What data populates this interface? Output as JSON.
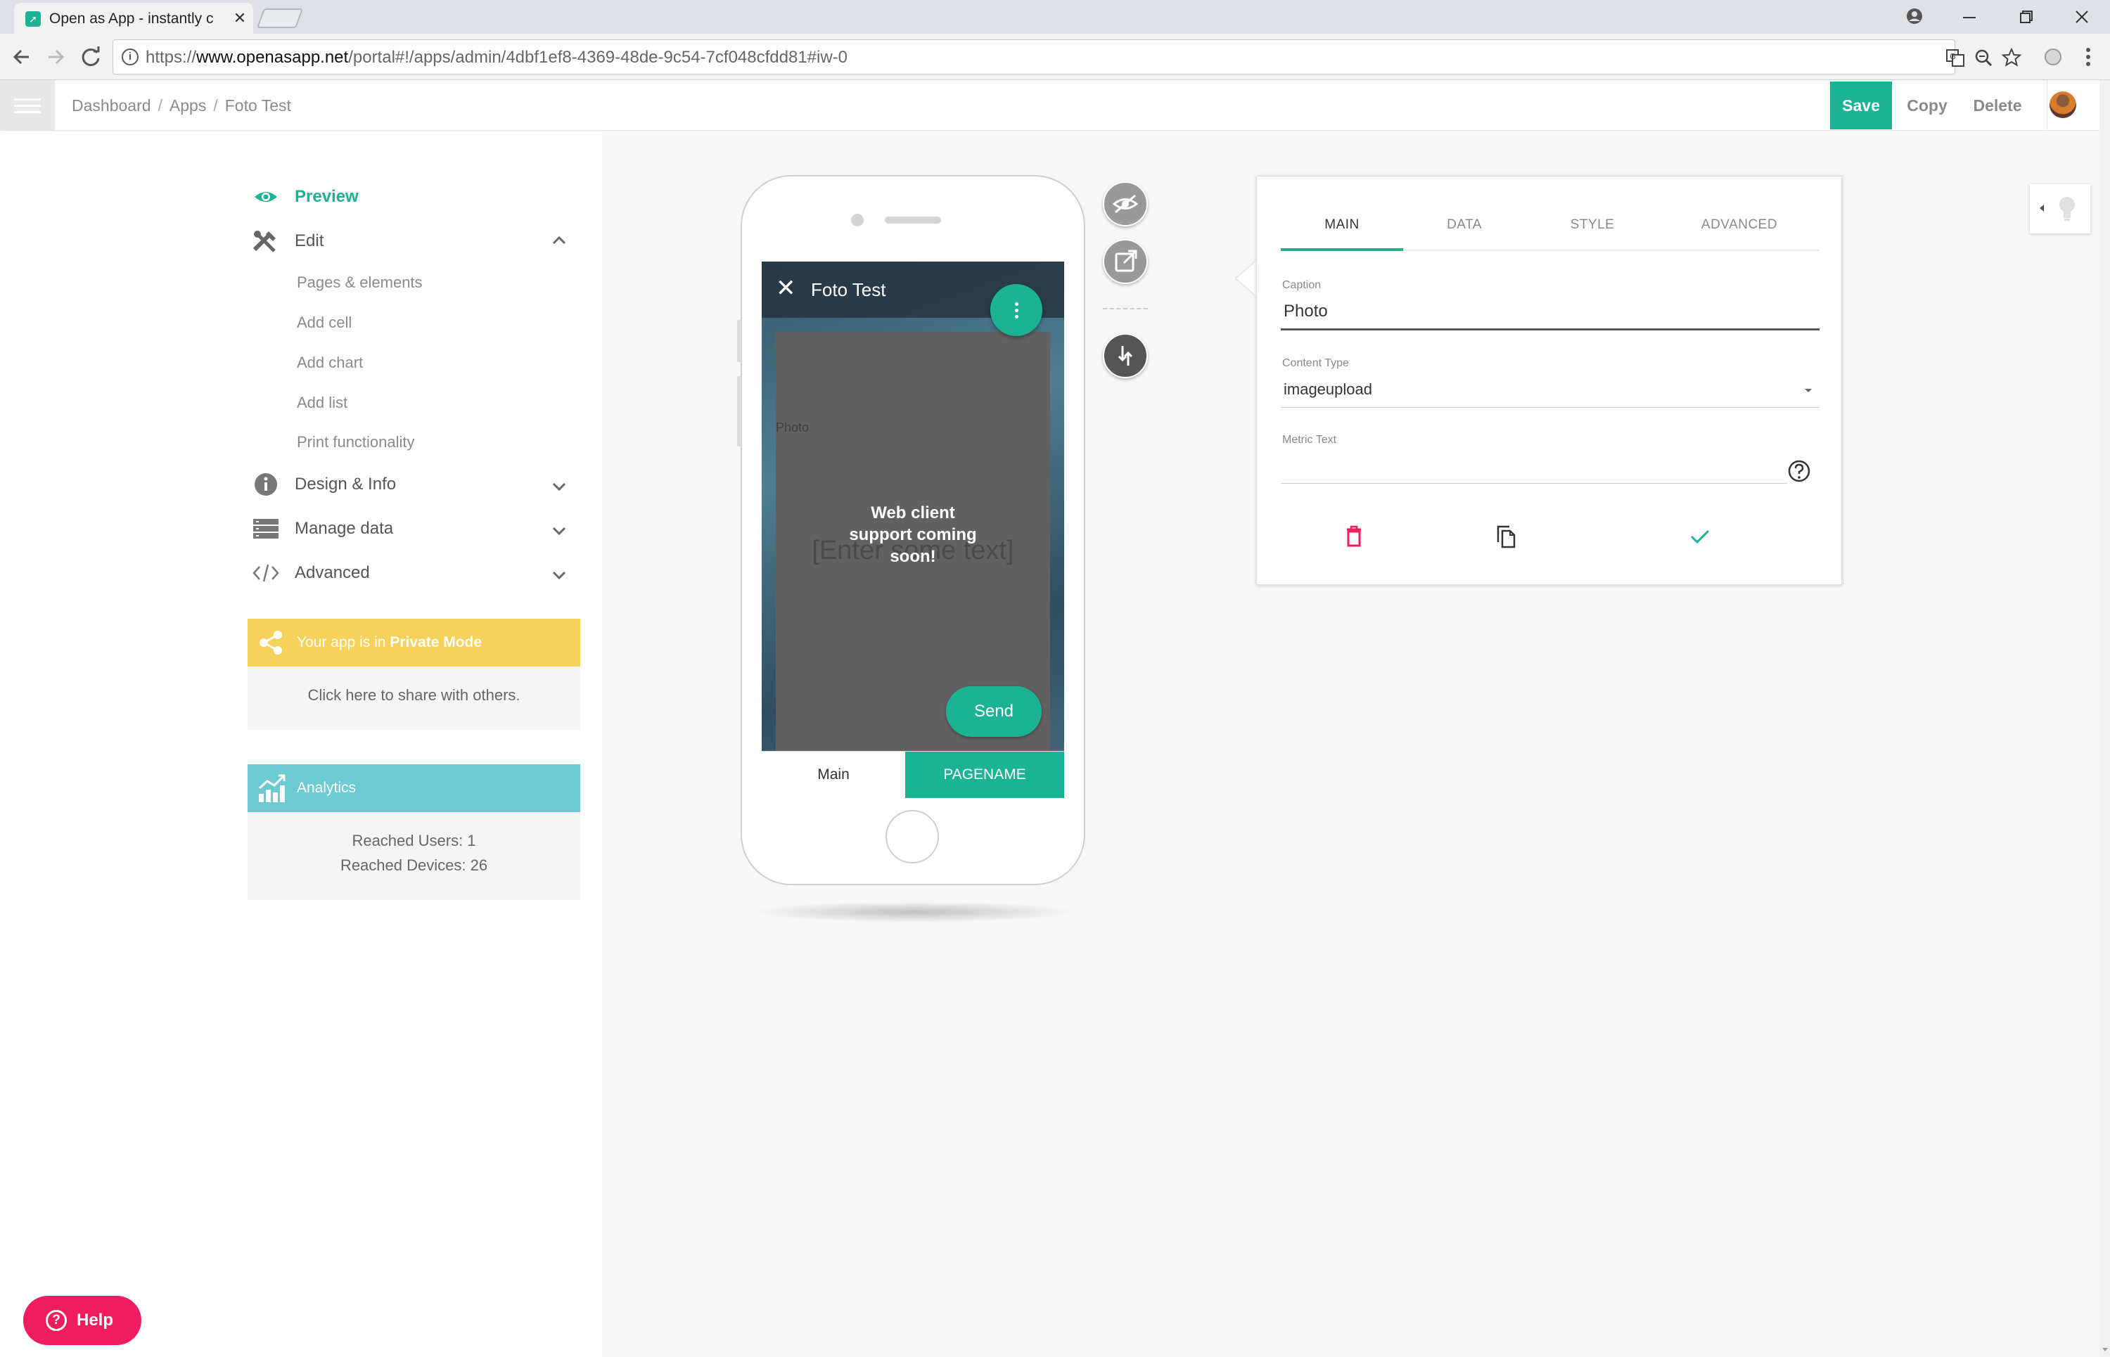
{
  "browser": {
    "tab_title": "Open as App - instantly c",
    "tab_close": "✕",
    "url_prefix": "https://",
    "url_host": "www.openasapp.net",
    "url_path": "/portal#!/apps/admin/4dbf1ef8-4369-48de-9c54-7cf048cfdd81#iw-0"
  },
  "header": {
    "breadcrumb": [
      "Dashboard",
      "Apps",
      "Foto Test"
    ],
    "separator": "/",
    "save_label": "Save",
    "copy_label": "Copy",
    "delete_label": "Delete"
  },
  "sidebar": {
    "preview_label": "Preview",
    "edit_label": "Edit",
    "edit_items": [
      "Pages & elements",
      "Add cell",
      "Add chart",
      "Add list",
      "Print functionality"
    ],
    "design_label": "Design & Info",
    "manage_label": "Manage data",
    "advanced_label": "Advanced",
    "private_prefix": "Your app is in ",
    "private_mode": "Private Mode",
    "share_text": "Click here to share with others.",
    "analytics_title": "Analytics",
    "reached_users": "Reached Users: 1",
    "reached_devices": "Reached Devices: 26",
    "help_icon": "?",
    "help_label": "Help"
  },
  "phone": {
    "close_icon": "✕",
    "app_title": "Foto Test",
    "photo_caption": "Photo",
    "placeholder": "[Enter some text]",
    "web_client_msg": "Web client support coming soon!",
    "send_label": "Send",
    "tab_main": "Main",
    "tab_pagename": "PAGENAME"
  },
  "panel": {
    "tabs": [
      "MAIN",
      "DATA",
      "STYLE",
      "ADVANCED"
    ],
    "caption_label": "Caption",
    "caption_value": "Photo",
    "content_type_label": "Content Type",
    "content_type_value": "imageupload",
    "metric_label": "Metric Text",
    "metric_value": ""
  },
  "colors": {
    "accent": "#1bb394",
    "private_mode": "#f7d25a",
    "analytics": "#6ccbd0",
    "help": "#ef1d5f",
    "delete_icon": "#ef1d5f"
  }
}
